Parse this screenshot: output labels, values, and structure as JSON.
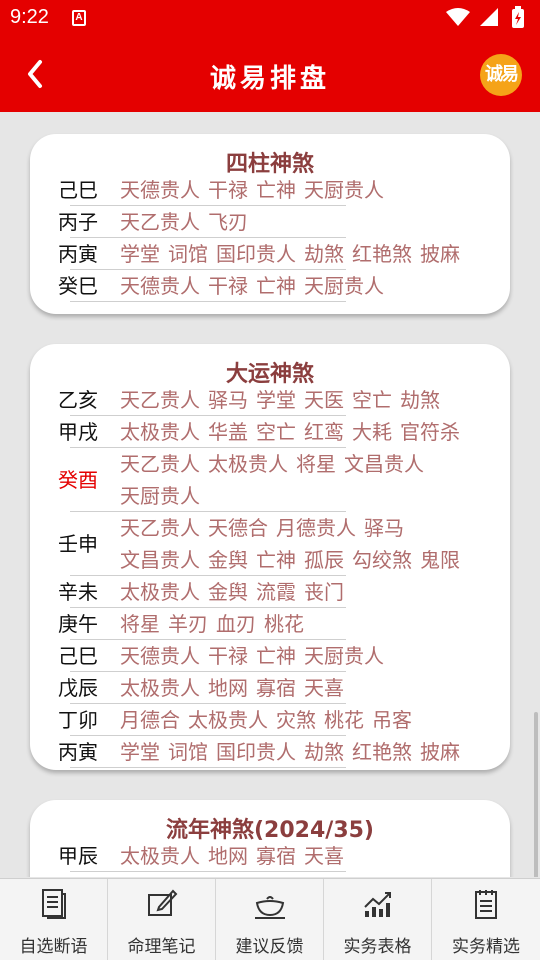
{
  "status": {
    "time": "9:22"
  },
  "appbar": {
    "title": "诚易排盘",
    "logo_text": "诚易"
  },
  "cards": [
    {
      "title": "四柱神煞",
      "rows": [
        {
          "gz": "己巳",
          "lines": [
            [
              "天德贵人",
              "干禄",
              "亡神",
              "天厨贵人"
            ]
          ]
        },
        {
          "gz": "丙子",
          "lines": [
            [
              "天乙贵人",
              "飞刃"
            ]
          ]
        },
        {
          "gz": "丙寅",
          "lines": [
            [
              "学堂",
              "词馆",
              "国印贵人",
              "劫煞",
              "红艳煞",
              "披麻"
            ]
          ]
        },
        {
          "gz": "癸巳",
          "lines": [
            [
              "天德贵人",
              "干禄",
              "亡神",
              "天厨贵人"
            ]
          ]
        }
      ]
    },
    {
      "title": "大运神煞",
      "rows": [
        {
          "gz": "乙亥",
          "lines": [
            [
              "天乙贵人",
              "驿马",
              "学堂",
              "天医",
              "空亡",
              "劫煞"
            ]
          ]
        },
        {
          "gz": "甲戌",
          "lines": [
            [
              "太极贵人",
              "华盖",
              "空亡",
              "红鸾",
              "大耗",
              "官符杀"
            ]
          ]
        },
        {
          "gz": "癸酉",
          "highlight": true,
          "lines": [
            [
              "天乙贵人",
              "太极贵人",
              "将星",
              "文昌贵人"
            ],
            [
              "天厨贵人"
            ]
          ]
        },
        {
          "gz": "壬申",
          "lines": [
            [
              "天乙贵人",
              "天德合",
              "月德贵人",
              "驿马"
            ],
            [
              "文昌贵人",
              "金舆",
              "亡神",
              "孤辰",
              "勾绞煞",
              "鬼限"
            ]
          ]
        },
        {
          "gz": "辛未",
          "lines": [
            [
              "太极贵人",
              "金舆",
              "流霞",
              "丧门"
            ]
          ]
        },
        {
          "gz": "庚午",
          "lines": [
            [
              "将星",
              "羊刃",
              "血刃",
              "桃花"
            ]
          ]
        },
        {
          "gz": "己巳",
          "lines": [
            [
              "天德贵人",
              "干禄",
              "亡神",
              "天厨贵人"
            ]
          ]
        },
        {
          "gz": "戊辰",
          "lines": [
            [
              "太极贵人",
              "地网",
              "寡宿",
              "天喜"
            ]
          ]
        },
        {
          "gz": "丁卯",
          "lines": [
            [
              "月德合",
              "太极贵人",
              "灾煞",
              "桃花",
              "吊客"
            ]
          ]
        },
        {
          "gz": "丙寅",
          "lines": [
            [
              "学堂",
              "词馆",
              "国印贵人",
              "劫煞",
              "红艳煞",
              "披麻"
            ]
          ]
        }
      ]
    },
    {
      "title": "流年神煞(2024/35)",
      "rows": [
        {
          "gz": "甲辰",
          "lines": [
            [
              "太极贵人",
              "地网",
              "寡宿",
              "天喜"
            ]
          ]
        }
      ]
    }
  ],
  "bottom_nav": [
    {
      "label": "自选断语",
      "icon": "document-icon"
    },
    {
      "label": "命理笔记",
      "icon": "edit-note-icon"
    },
    {
      "label": "建议反馈",
      "icon": "teacup-icon"
    },
    {
      "label": "实务表格",
      "icon": "chart-trend-icon"
    },
    {
      "label": "实务精选",
      "icon": "notepad-icon"
    }
  ]
}
